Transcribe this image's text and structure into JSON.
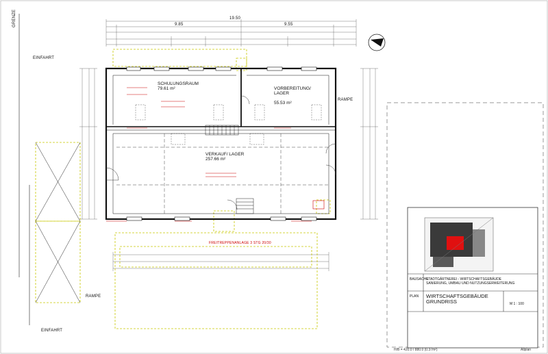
{
  "site": {
    "boundary_label": "GRENZE",
    "entrance_top": "EINFAHRT",
    "entrance_bottom": "EINFAHRT",
    "ramp_left": "RAMPE",
    "ramp_right": "RAMPE"
  },
  "rooms": {
    "training": {
      "name": "SCHULUNGSRAUM",
      "area": "79.61 m²"
    },
    "preparation": {
      "name": "VORBEREITUNG/\nLAGER",
      "area": "55.53 m²"
    },
    "sales": {
      "name": "VERKAUF/ LAGER",
      "area": "257.66 m²"
    },
    "stairs_note": "FREITREPPENANLAGE 3 STG 20/30"
  },
  "dimensions": {
    "top_total": "19.50",
    "top_left": "9.85",
    "top_right": "9.55"
  },
  "title_block": {
    "project_label": "BAUSACHE",
    "project_line1": "STADTGÄRTNEREI - WIRTSCHAFTSGEBÄUDE",
    "project_line2": "SANIERUNG, UMBAU UND NUTZUNGSERWEITERUNG",
    "plan_label": "PLAN",
    "plan_line1": "WIRTSCHAFTSGEBÄUDE",
    "plan_line2": "GRUNDRISS",
    "scale": "M 1 : 100"
  },
  "footer": {
    "sheet_size": "H/B = 420.0 / 880.0 (0.37m²)",
    "software": "Allplan"
  },
  "colors": {
    "line": "#222222",
    "demolition": "#c8c800",
    "red_note": "#cc0000",
    "highlight": "#e01010"
  }
}
